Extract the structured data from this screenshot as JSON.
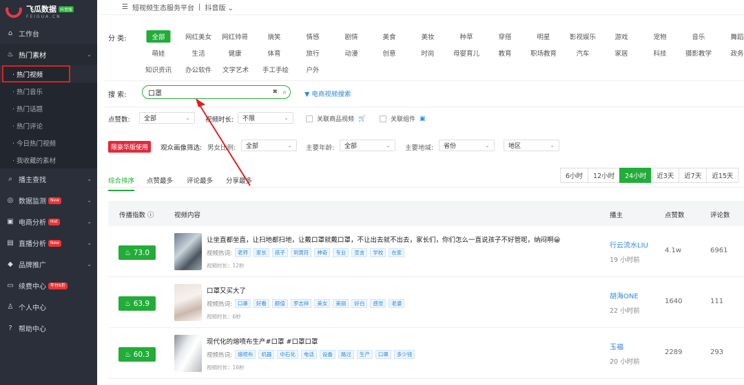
{
  "sidebar": {
    "logo_title": "飞瓜数据",
    "logo_badge": "抖音版",
    "logo_sub": "FEIGUA.CN",
    "items": [
      {
        "label": "工作台",
        "icon": "home-icon"
      },
      {
        "label": "热门素材",
        "icon": "fire-icon"
      },
      {
        "label": "播主查找",
        "icon": "search-icon"
      },
      {
        "label": "数据监测",
        "icon": "monitor-icon",
        "badge": "New"
      },
      {
        "label": "电商分析",
        "icon": "shop-icon",
        "badge": "Hot"
      },
      {
        "label": "直播分析",
        "icon": "live-icon",
        "badge": "New"
      },
      {
        "label": "品牌推广",
        "icon": "diamond-icon"
      },
      {
        "label": "续费中心",
        "icon": "card-icon",
        "badge": "年付6折"
      },
      {
        "label": "个人中心",
        "icon": "user-icon"
      },
      {
        "label": "帮助中心",
        "icon": "help-icon"
      }
    ],
    "sub_items": [
      "· 热门视频",
      "· 热门音乐",
      "· 热门话题",
      "· 热门评论",
      "· 今日热门视频",
      "· 我收藏的素材"
    ]
  },
  "topbar": {
    "menu_icon": "☰",
    "platform": "短视频生态服务平台",
    "divider": "|",
    "version": "抖音版"
  },
  "categories": {
    "label": "分  类:",
    "active": "全部",
    "row1": [
      "网红美女",
      "网红帅哥",
      "搞笑",
      "情感",
      "剧情",
      "美食",
      "美妆",
      "种草",
      "穿搭",
      "明星",
      "影视娱乐",
      "游戏",
      "宠物",
      "音乐",
      "舞蹈"
    ],
    "row2": [
      "萌娃",
      "生活",
      "健康",
      "体育",
      "旅行",
      "动漫",
      "创意",
      "时尚",
      "母婴育儿",
      "教育",
      "职场教育",
      "汽车",
      "家居",
      "科技",
      "摄影教学",
      "政务"
    ],
    "row3": [
      "知识资讯",
      "办公软件",
      "文学艺术",
      "手工手绘",
      "户外"
    ]
  },
  "search": {
    "label": "搜  索:",
    "value": "口罩",
    "clear": "✖",
    "ecom_link": "电商视频搜索"
  },
  "filters": {
    "likes_label": "点赞数:",
    "likes_value": "全部",
    "duration_label": "视频时长:",
    "duration_value": "不限",
    "goods_label": "关联商品视频",
    "component_label": "关联组件",
    "lux_button": "限豪华版使用",
    "audience_label": "观众画像筛选:",
    "gender_label": "男女比例:",
    "gender_value": "全部",
    "age_label": "主要年龄:",
    "age_value": "全部",
    "region_label": "主要地域:",
    "province_value": "省份",
    "district_value": "地区"
  },
  "sort_tabs": [
    "综合排序",
    "点赞最多",
    "评论最多",
    "分享最多"
  ],
  "time_tabs": [
    "6小时",
    "12小时",
    "24小时",
    "近3天",
    "近7天",
    "近15天"
  ],
  "active_time_tab": "24小时",
  "table": {
    "headers": {
      "score": "传播指数",
      "content": "视频内容",
      "anchor": "播主",
      "likes": "点赞数",
      "comments": "评论数"
    },
    "hot_label": "视频热词:",
    "rows": [
      {
        "score": "73.0",
        "title": "让坐直都坐直，让扫地都扫地，让戴口罩就戴口罩，不让出去就不出去，家长们，你们怎么一直说孩子不好管呢，纳闷啊😀",
        "keywords": [
          "老师",
          "家长",
          "孩子",
          "到黄符",
          "神奇",
          "专业",
          "圣言",
          "学校",
          "在家"
        ],
        "duration": "视频时长：12秒",
        "anchor": "行云流水LIU",
        "ago": "19 小时前",
        "likes": "4.1w",
        "comments": "6961"
      },
      {
        "score": "63.9",
        "title": "口罩又买大了",
        "keywords": [
          "口罩",
          "好看",
          "颜值",
          "罗志祥",
          "美女",
          "美丽",
          "好白",
          "感觉",
          "老婆"
        ],
        "duration": "视频时长：6秒",
        "anchor": "胡海ONE",
        "ago": "22 小时前",
        "likes": "1640",
        "comments": "111"
      },
      {
        "score": "60.3",
        "title": "现代化的熔喷布生产#口罩 #口罩口罩",
        "keywords": [
          "熔喷布",
          "机器",
          "中石化",
          "电话",
          "设备",
          "路过",
          "生产",
          "口罩",
          "多少钱"
        ],
        "duration": "视频时长：16秒",
        "anchor": "玉福",
        "ago": "20 小时前",
        "likes": "2289",
        "comments": "293"
      }
    ]
  },
  "colors": {
    "brand_green": "#22ac38",
    "sidebar_bg": "#2b2f3a",
    "link_blue": "#2e8ad8",
    "annotation_red": "#e02020"
  }
}
